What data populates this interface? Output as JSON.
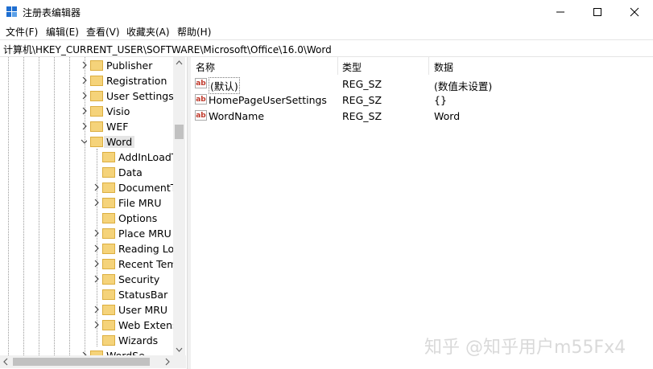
{
  "window": {
    "title": "注册表编辑器"
  },
  "menu": [
    {
      "label": "文件(F)"
    },
    {
      "label": "编辑(E)"
    },
    {
      "label": "查看(V)"
    },
    {
      "label": "收藏夹(A)"
    },
    {
      "label": "帮助(H)"
    }
  ],
  "address": "计算机\\HKEY_CURRENT_USER\\SOFTWARE\\Microsoft\\Office\\16.0\\Word",
  "tree": [
    {
      "label": "Publisher",
      "level": 0,
      "chevron": "right"
    },
    {
      "label": "Registration",
      "level": 0,
      "chevron": "right"
    },
    {
      "label": "User Settings",
      "level": 0,
      "chevron": "right"
    },
    {
      "label": "Visio",
      "level": 0,
      "chevron": "right"
    },
    {
      "label": "WEF",
      "level": 0,
      "chevron": "right"
    },
    {
      "label": "Word",
      "level": 0,
      "chevron": "down",
      "selected": true
    },
    {
      "label": "AddInLoadT",
      "level": 1,
      "chevron": "none"
    },
    {
      "label": "Data",
      "level": 1,
      "chevron": "none"
    },
    {
      "label": "DocumentTe",
      "level": 1,
      "chevron": "right"
    },
    {
      "label": "File MRU",
      "level": 1,
      "chevron": "right"
    },
    {
      "label": "Options",
      "level": 1,
      "chevron": "none"
    },
    {
      "label": "Place MRU",
      "level": 1,
      "chevron": "right"
    },
    {
      "label": "Reading Loc",
      "level": 1,
      "chevron": "right"
    },
    {
      "label": "Recent Temp",
      "level": 1,
      "chevron": "right"
    },
    {
      "label": "Security",
      "level": 1,
      "chevron": "right"
    },
    {
      "label": "StatusBar",
      "level": 1,
      "chevron": "none"
    },
    {
      "label": "User MRU",
      "level": 1,
      "chevron": "right"
    },
    {
      "label": "Web Extensi",
      "level": 1,
      "chevron": "right"
    },
    {
      "label": "Wizards",
      "level": 1,
      "chevron": "none"
    },
    {
      "label": "WordSe",
      "level": 0,
      "chevron": "right"
    }
  ],
  "columns": {
    "name": "名称",
    "type": "类型",
    "data": "数据"
  },
  "values": [
    {
      "name": "(默认)",
      "type": "REG_SZ",
      "data": "(数值未设置)"
    },
    {
      "name": "HomePageUserSettings",
      "type": "REG_SZ",
      "data": "{}"
    },
    {
      "name": "WordName",
      "type": "REG_SZ",
      "data": "Word"
    }
  ],
  "icons": {
    "value_icon_text": "ab"
  },
  "watermark": "知乎 @知乎用户m55Fx4",
  "colors": {
    "folder": "#f5d37a",
    "folder_edge": "#dcae3f",
    "selected_bg": "#e5e5e5",
    "app_icon": "#1f6fd1"
  }
}
